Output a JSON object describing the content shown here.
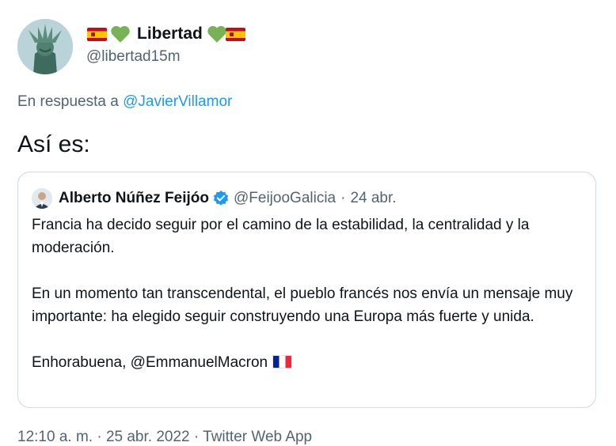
{
  "author": {
    "display_name": "Libertad",
    "handle": "@libertad15m",
    "name_decorations": [
      "spain-flag",
      "green-heart",
      "green-heart",
      "spain-flag"
    ]
  },
  "reply": {
    "prefix": "En respuesta a",
    "mention": "@JavierVillamor"
  },
  "tweet": {
    "text": "Así es:"
  },
  "quoted": {
    "display_name": "Alberto Núñez Feijóo",
    "verified": true,
    "handle": "@FeijooGalicia",
    "separator": "·",
    "date": "24 abr.",
    "lines": [
      "Francia ha decido seguir por el camino de la estabilidad, la centralidad y la moderación.",
      "En un momento tan transcendental, el pueblo francés nos envía un mensaje muy importante: ha elegido seguir construyendo una Europa más fuerte y unida.",
      "Enhorabuena, @EmmanuelMacron"
    ],
    "trailing_icon": "france-flag"
  },
  "meta": {
    "text": "12:10 a. m. · 25 abr. 2022 · Twitter Web App"
  },
  "colors": {
    "text": "#0f1419",
    "secondary": "#536471",
    "link": "#1d9bf0",
    "border": "#cfd9de",
    "heart": "#77b255",
    "verified": "#1d9bf0"
  }
}
